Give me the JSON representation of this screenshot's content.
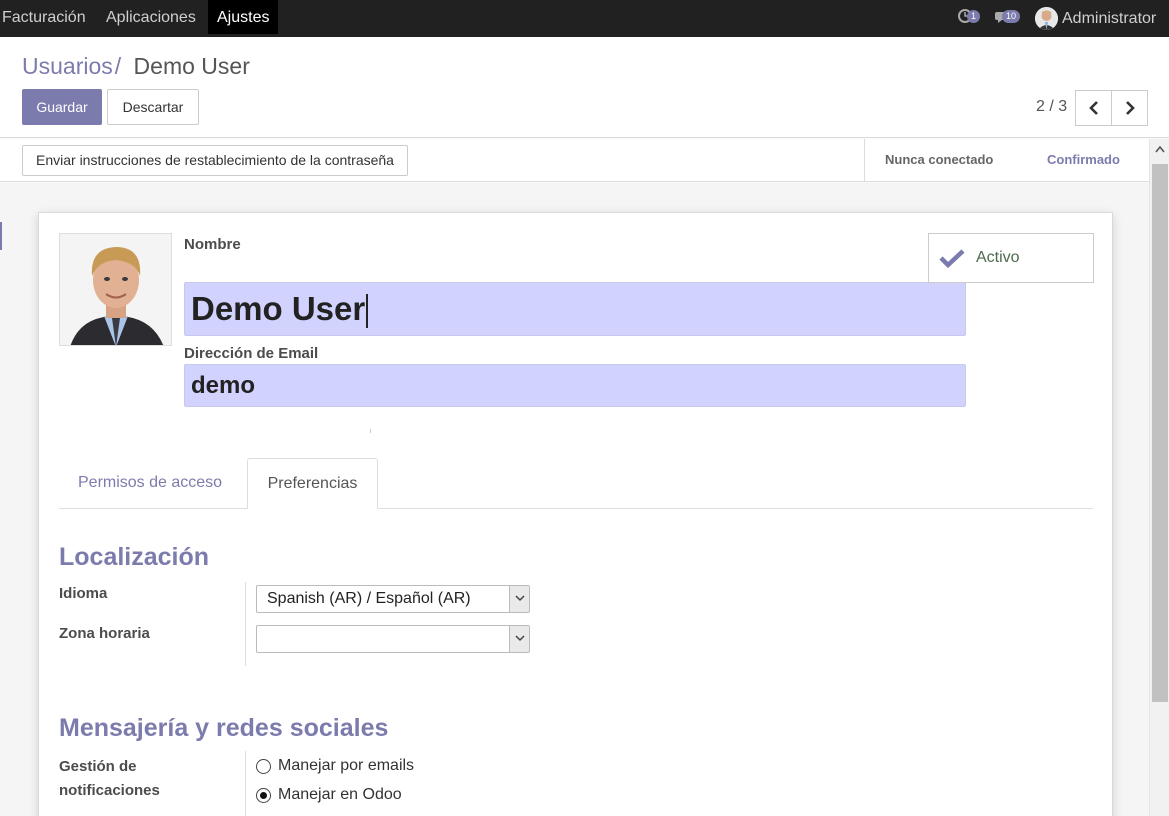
{
  "navbar": {
    "menu": [
      "Facturación",
      "Aplicaciones",
      "Ajustes"
    ],
    "activity_count": "1",
    "message_count": "10",
    "user_name": "Administrator"
  },
  "breadcrumb": {
    "parent": "Usuarios",
    "separator": "/",
    "current": "Demo User"
  },
  "toolbar": {
    "save_label": "Guardar",
    "discard_label": "Descartar"
  },
  "pager": {
    "value": "2 / 3"
  },
  "statusbar": {
    "action_label": "Enviar instrucciones de restablecimiento de la contraseña",
    "stages": [
      "Nunca conectado",
      "Confirmado"
    ],
    "current_stage": "Confirmado"
  },
  "form": {
    "name_label": "Nombre",
    "name_value": "Demo User",
    "email_label": "Dirección de Email",
    "email_value": "demo",
    "active_label": "Activo"
  },
  "tabs": [
    "Permisos de acceso",
    "Preferencias"
  ],
  "active_tab": "Preferencias",
  "localization": {
    "title": "Localización",
    "language_label": "Idioma",
    "language_value": "Spanish (AR) / Español (AR)",
    "timezone_label": "Zona horaria",
    "timezone_value": ""
  },
  "messaging": {
    "title": "Mensajería y redes sociales",
    "notification_label_line1": "Gestión de",
    "notification_label_line2": "notificaciones",
    "options": [
      "Manejar por emails",
      "Manejar en Odoo"
    ],
    "selected": "Manejar en Odoo"
  },
  "colors": {
    "accent": "#7c7bad",
    "navbar": "#212121",
    "input_highlight": "#d2d2ff"
  }
}
